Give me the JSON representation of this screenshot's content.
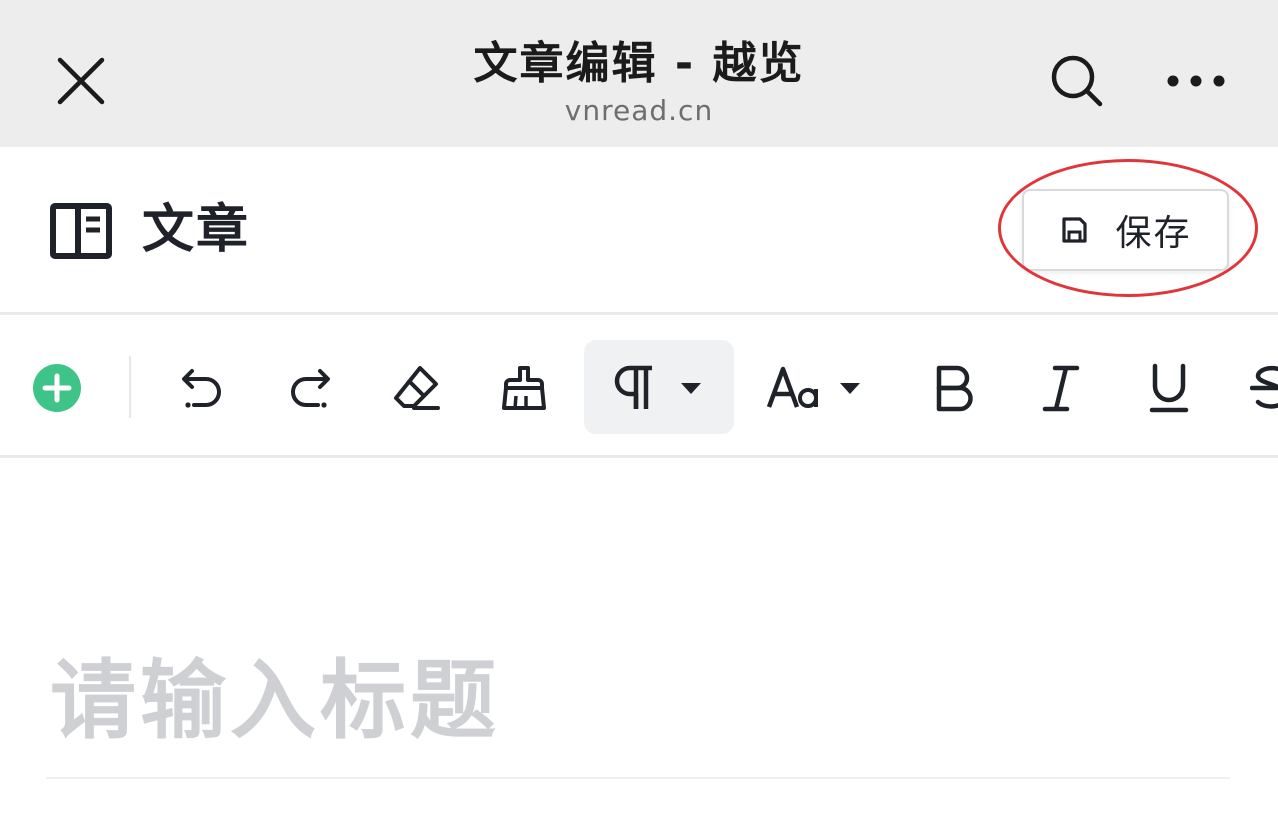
{
  "browser": {
    "title": "文章编辑 - 越览",
    "domain": "vnread.cn",
    "close_icon": "close-icon",
    "search_icon": "search-icon",
    "more_icon": "more-icon"
  },
  "header": {
    "doc_icon": "sidebar-layout-icon",
    "title": "文章",
    "save_button": {
      "icon": "floppy-disk-icon",
      "label": "保存",
      "highlighted": true,
      "highlight_color": "#e0363b"
    }
  },
  "toolbar": {
    "items": [
      {
        "name": "insert",
        "icon": "plus-circle-icon",
        "color": "#3fc488"
      },
      {
        "name": "undo",
        "icon": "undo-icon"
      },
      {
        "name": "redo",
        "icon": "redo-icon"
      },
      {
        "name": "clear-format",
        "icon": "eraser-icon"
      },
      {
        "name": "format-painter",
        "icon": "brush-icon"
      },
      {
        "name": "paragraph",
        "icon": "pilcrow-icon",
        "dropdown": true,
        "active": true
      },
      {
        "name": "font-size",
        "icon": "font-size-icon",
        "dropdown": true
      },
      {
        "name": "bold",
        "icon": "bold-icon"
      },
      {
        "name": "italic",
        "icon": "italic-icon"
      },
      {
        "name": "underline",
        "icon": "underline-icon"
      },
      {
        "name": "strikethrough",
        "icon": "strikethrough-icon"
      }
    ]
  },
  "editor": {
    "title_placeholder": "请输入标题",
    "title_value": ""
  },
  "colors": {
    "topbar_bg": "#ededed",
    "accent_green": "#3fc488",
    "placeholder": "#cfd0d4",
    "text": "#1f2329"
  }
}
